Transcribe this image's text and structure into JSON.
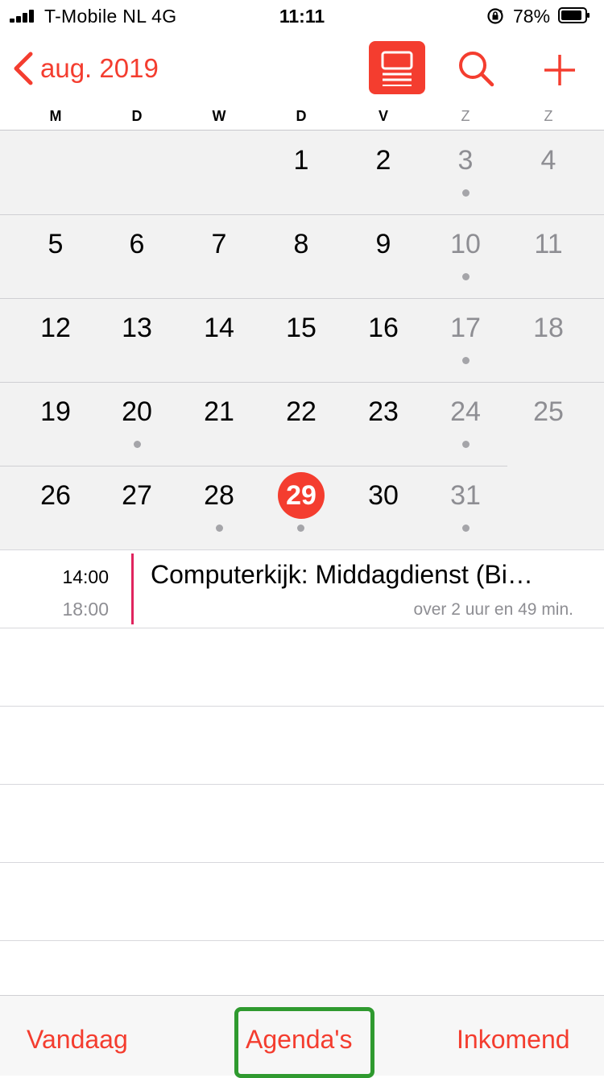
{
  "status": {
    "carrier": "T-Mobile NL  4G",
    "time": "11:11",
    "battery": "78%"
  },
  "nav": {
    "month_label": "aug. 2019"
  },
  "weekdays": [
    "M",
    "D",
    "W",
    "D",
    "V",
    "Z",
    "Z"
  ],
  "weeks": [
    [
      "",
      "",
      "",
      "1",
      "2",
      "3",
      "4"
    ],
    [
      "5",
      "6",
      "7",
      "8",
      "9",
      "10",
      "11"
    ],
    [
      "12",
      "13",
      "14",
      "15",
      "16",
      "17",
      "18"
    ],
    [
      "19",
      "20",
      "21",
      "22",
      "23",
      "24",
      "25"
    ],
    [
      "26",
      "27",
      "28",
      "29",
      "30",
      "31",
      ""
    ]
  ],
  "today": "29",
  "event": {
    "start": "14:00",
    "end": "18:00",
    "title": "Computerkijk: Middagdienst  (Bi…",
    "subtitle": "over 2 uur en 49 min."
  },
  "toolbar": {
    "today": "Vandaag",
    "calendars": "Agenda's",
    "inbox": "Inkomend"
  },
  "colors": {
    "accent": "#f43d2f",
    "event_bar": "#e0245e",
    "highlight": "#2f9a2f"
  }
}
